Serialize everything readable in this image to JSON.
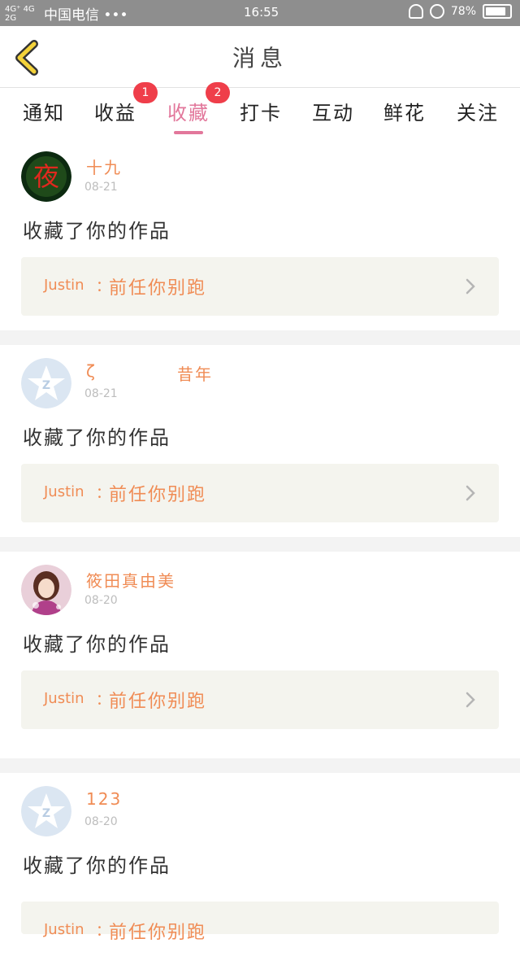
{
  "status_bar": {
    "network_top": "4G⁺ 4G",
    "network_bottom": "2G",
    "carrier": "中国电信 •••",
    "time": "16:55",
    "battery": "78%",
    "battery_level": 0.78
  },
  "header": {
    "title": "消息",
    "back_icon": "chevron-left-icon"
  },
  "tabs": [
    {
      "label": "通知"
    },
    {
      "label": "收益",
      "badge": "1"
    },
    {
      "label": "收藏",
      "badge": "2",
      "active": true
    },
    {
      "label": "打卡"
    },
    {
      "label": "互动"
    },
    {
      "label": "鲜花"
    },
    {
      "label": "关注"
    }
  ],
  "items": [
    {
      "user": "十九",
      "user_extra": "",
      "date": "08-21",
      "action": "收藏了你的作品",
      "author": "Justin",
      "separator": "：",
      "work_title": "前任你别跑",
      "avatar": "night-logo"
    },
    {
      "user": "ζ",
      "user_extra": "昔年",
      "date": "08-21",
      "action": "收藏了你的作品",
      "author": "Justin",
      "separator": "：",
      "work_title": "前任你别跑",
      "avatar": "default-star"
    },
    {
      "user": "筱田真由美",
      "user_extra": "",
      "date": "08-20",
      "action": "收藏了你的作品",
      "author": "Justin",
      "separator": "：",
      "work_title": "前任你别跑",
      "avatar": "anime-girl"
    },
    {
      "user": "123",
      "user_extra": "",
      "date": "08-20",
      "action": "收藏了你的作品",
      "author": "Justin",
      "separator": "：",
      "work_title": "前任你别跑",
      "avatar": "default-star"
    }
  ],
  "colors": {
    "accent": "#e2779b",
    "name": "#f08c55",
    "badge": "#ef3e4a",
    "work_bg": "#f4f4ee",
    "back_arrow": "#f3d23a"
  }
}
